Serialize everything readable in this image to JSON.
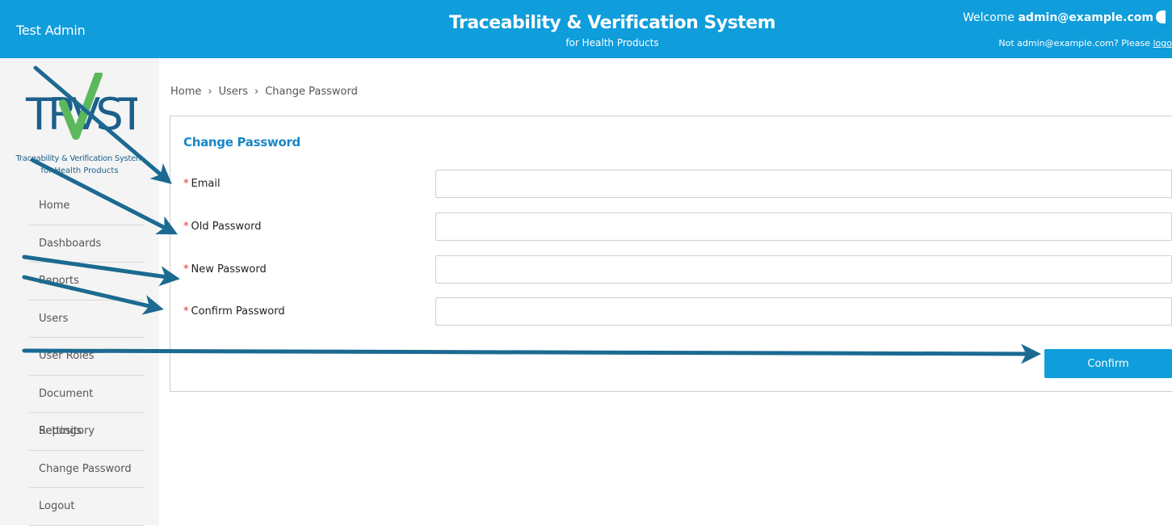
{
  "header": {
    "user_name": "Test Admin",
    "title": "Traceability & Verification System",
    "subtitle": "for Health Products",
    "welcome_prefix": "Welcome",
    "welcome_email": "admin@example.com",
    "not_user_text": "Not admin@example.com? Please",
    "logout_link": "logo",
    "bg_color": "#0f9ddb"
  },
  "logo": {
    "wordmark": "TRVST",
    "tagline_line1": "Traceability & Verification System",
    "tagline_line2": "for Health Products"
  },
  "sidebar": {
    "items": [
      {
        "label": "Home"
      },
      {
        "label": "Dashboards"
      },
      {
        "label": "Reports"
      },
      {
        "label": "Users"
      },
      {
        "label": "User Roles"
      },
      {
        "label": "Document Repository"
      },
      {
        "label": "Settings"
      },
      {
        "label": "Change Password"
      },
      {
        "label": "Logout"
      }
    ]
  },
  "breadcrumb": {
    "items": [
      "Home",
      "Users",
      "Change Password"
    ],
    "separator": "›"
  },
  "form": {
    "title": "Change Password",
    "required_marker": "*",
    "fields": [
      {
        "label": "Email",
        "value": ""
      },
      {
        "label": "Old Password",
        "value": ""
      },
      {
        "label": "New Password",
        "value": ""
      },
      {
        "label": "Confirm Password",
        "value": ""
      }
    ],
    "confirm_label": "Confirm"
  },
  "colors": {
    "accent": "#0f9ddb",
    "arrow": "#1b6a91",
    "required": "#d9322b",
    "logo_check": "#5cb85c"
  }
}
